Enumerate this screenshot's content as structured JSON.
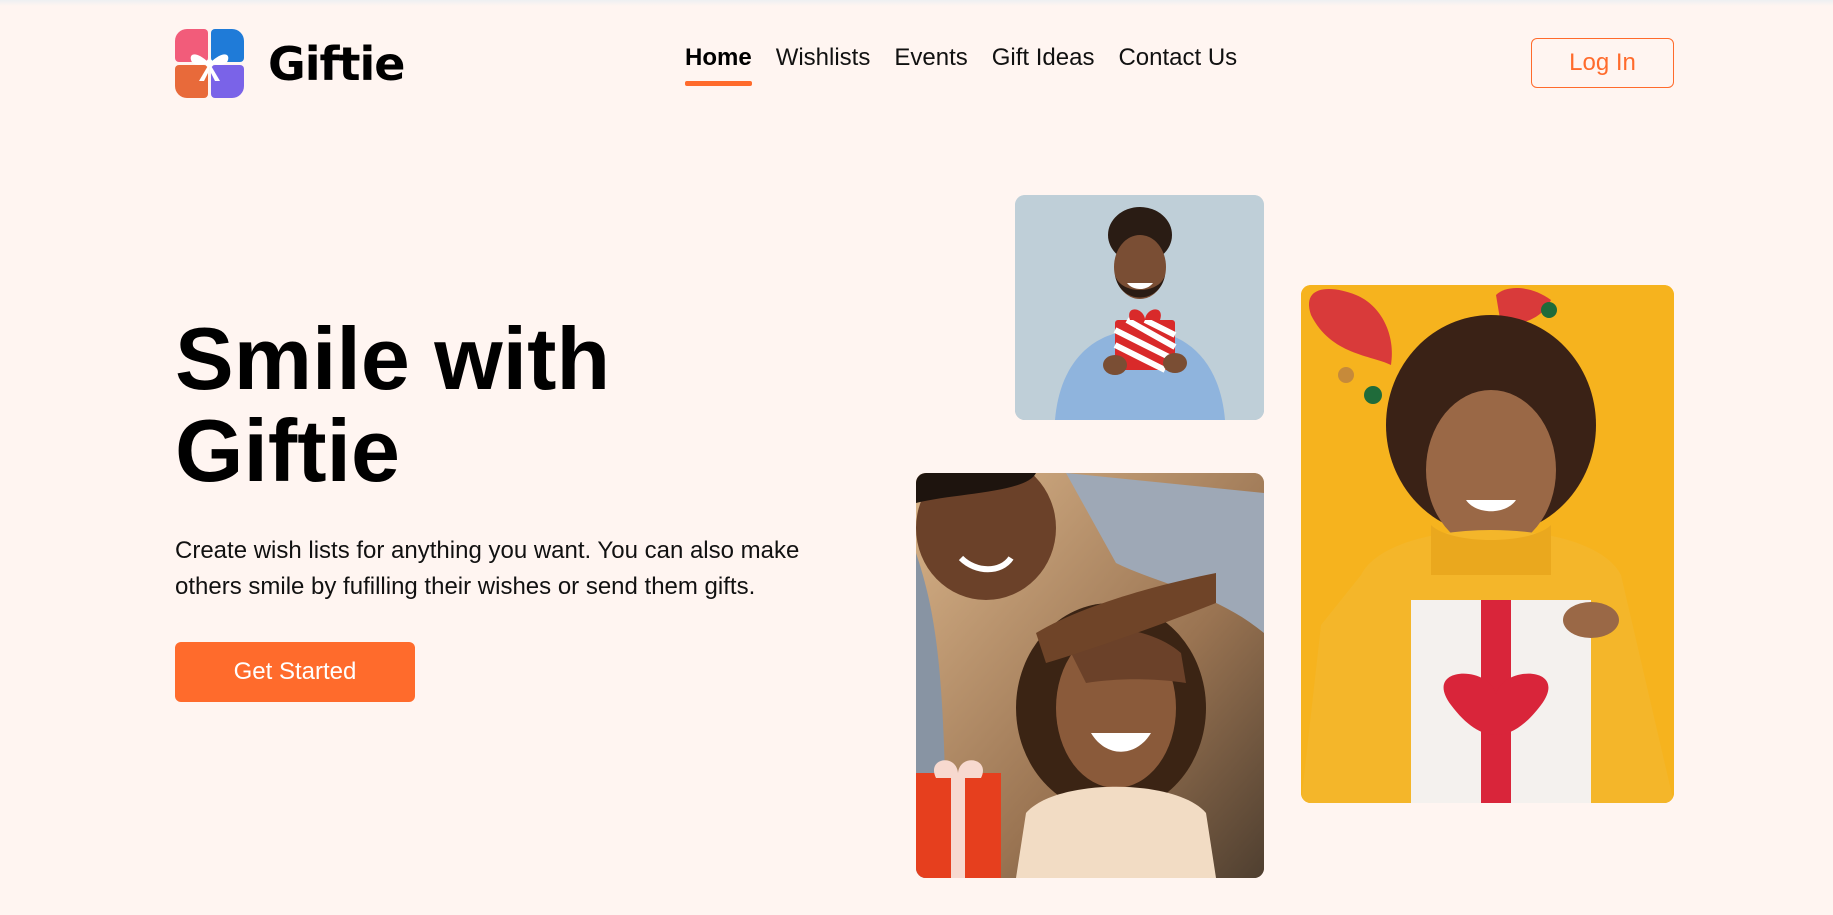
{
  "brand": {
    "name": "Giftie"
  },
  "nav": {
    "items": [
      {
        "label": "Home",
        "active": true
      },
      {
        "label": "Wishlists",
        "active": false
      },
      {
        "label": "Events",
        "active": false
      },
      {
        "label": "Gift Ideas",
        "active": false
      },
      {
        "label": "Contact Us",
        "active": false
      }
    ]
  },
  "header": {
    "login_label": "Log In"
  },
  "hero": {
    "title_line1": "Smile with",
    "title_line2": "Giftie",
    "subtitle": "Create wish lists for anything you want. You can also make others smile by fufilling their wishes or send them gifts.",
    "cta_label": "Get Started"
  },
  "colors": {
    "background": "#fff5f1",
    "accent": "#ff6b2c"
  }
}
